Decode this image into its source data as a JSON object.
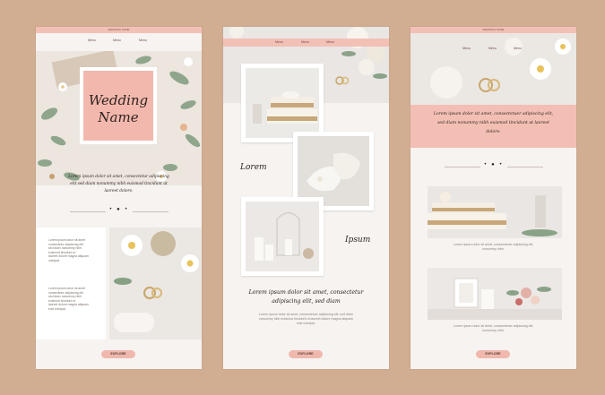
{
  "cards": {
    "card1": {
      "topbar_text": "WEDDING NAME",
      "nav": [
        "Menu",
        "Menu",
        "Menu"
      ],
      "hero_title_line1": "Wedding",
      "hero_title_line2": "Name",
      "intro_lines": [
        "Lorem ipsum dolor sit amet, consectetur adipiscing",
        "elit sed diam nonummy nibh euismod tincidunt ut",
        "laoreet dolore."
      ],
      "dots": "• ● •",
      "col_text_a": [
        "Lorem ipsum dolor sit amet",
        "consectetur adipiscing elit",
        "sed diam nonummy nibh",
        "euismod tincidunt ut",
        "laoreet dolore magna aliquam",
        "volutpat."
      ],
      "col_text_b": [
        "Lorem ipsum dolor sit amet",
        "consectetur adipiscing elit",
        "sed diam nonummy nibh",
        "euismod tincidunt ut",
        "laoreet dolore magna aliquam",
        "erat volutpat."
      ],
      "button": "EXPLORE"
    },
    "card2": {
      "nav": [
        "Menu",
        "Menu",
        "Menu"
      ],
      "label_left": "Lorem",
      "label_right": "Ipsum",
      "heading_line1": "Lorem ipsum dolor sit amet, consectetur",
      "heading_line2": "adipiscing elit, sed diam",
      "body_lines": [
        "Lorem ipsum dolor sit amet, consectetuer adipiscing elit, sed diam",
        "nonummy nibh euismod tincidunt ut laoreet dolore magna aliquam",
        "erat volutpat."
      ],
      "button": "EXPLORE"
    },
    "card3": {
      "topbar_text": "WEDDING NAME",
      "nav": [
        "Menu",
        "Menu",
        "Menu"
      ],
      "band_lines": [
        "Lorem ipsum dolor sit amet, consectetuer adipiscing elit,",
        "sed diam nonummy nibh euismod tincidunt ut laoreet",
        "dolore."
      ],
      "dots": "• ● •",
      "caption1": [
        "Lorem ipsum dolor sit amet, consectetuer adipiscing elit,",
        "nonummy nibh."
      ],
      "caption2": [
        "Lorem ipsum dolor sit amet, consectetuer adipiscing elit,",
        "nonummy nibh."
      ],
      "button": "EXPLORE"
    }
  },
  "colors": {
    "background": "#d1ad92",
    "card": "#f6f3f1",
    "accent_pink": "#f3c0b6",
    "button": "#f0b8ac"
  }
}
